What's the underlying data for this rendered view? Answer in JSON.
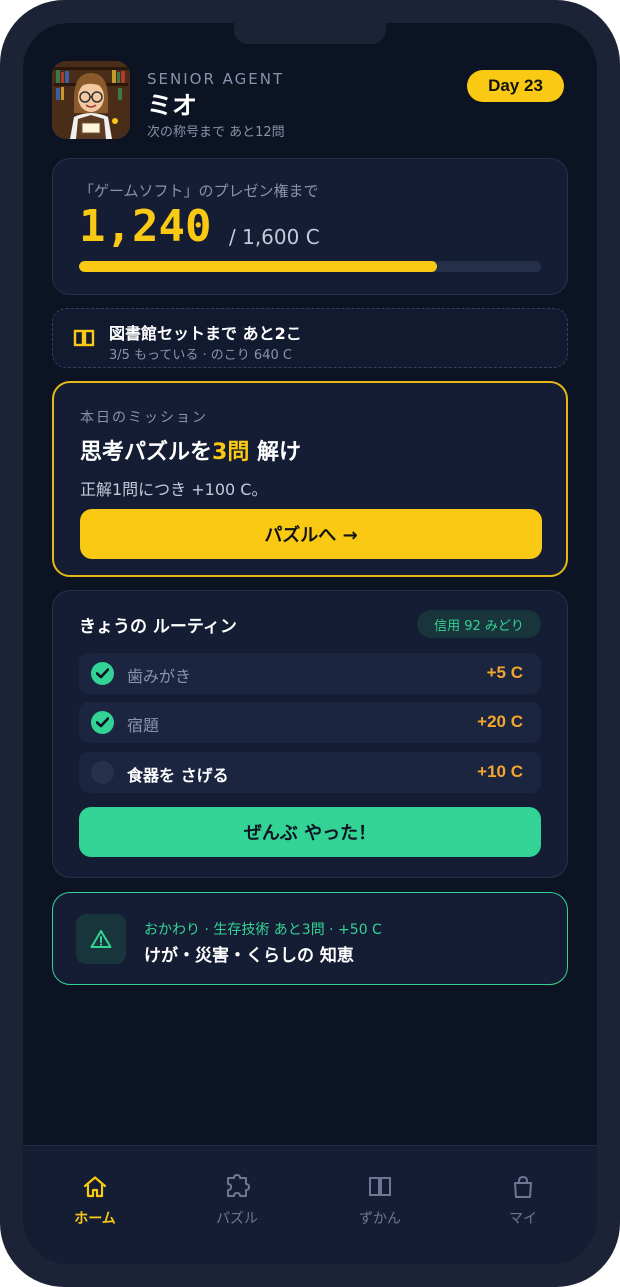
{
  "profile": {
    "rank": "SENIOR AGENT",
    "name": "ミオ",
    "next_title": "次の称号まで あと12問",
    "day": "Day 23"
  },
  "goal": {
    "label": "「ゲームソフト」のプレゼン権まで",
    "current": "1,240",
    "total": "/ 1,600 C",
    "progress": 0.775
  },
  "set": {
    "title": "図書館セットまで あと2こ",
    "sub": "3/5 もっている · のこり 640 C"
  },
  "mission": {
    "label": "本日のミッション",
    "title_pre": "思考パズルを",
    "title_num": "3問",
    "title_post": " 解け",
    "desc": "正解1問につき +100 C。",
    "button": "パズルへ →"
  },
  "routine": {
    "title": "きょうの ルーティン",
    "credit": "信用 92 みどり",
    "items": [
      {
        "label": "歯みがき",
        "reward": "+5 C",
        "done": true
      },
      {
        "label": "宿題",
        "reward": "+20 C",
        "done": true
      },
      {
        "label": "食器を さげる",
        "reward": "+10 C",
        "done": false
      }
    ],
    "button": "ぜんぶ やった！"
  },
  "next_topic": {
    "sub": "おかわり · 生存技術 あと3問 · +50 C",
    "title": "けが・災害・くらしの 知恵"
  },
  "tabs": [
    {
      "label": "ホーム",
      "icon": "home-icon",
      "active": true
    },
    {
      "label": "パズル",
      "icon": "puzzle-icon",
      "active": false
    },
    {
      "label": "ずかん",
      "icon": "book-icon",
      "active": false
    },
    {
      "label": "マイ",
      "icon": "bag-icon",
      "active": false
    }
  ],
  "colors": {
    "accent": "#f9c913",
    "success": "#33d396",
    "reward": "#f4a52c",
    "background": "#0c1322"
  }
}
